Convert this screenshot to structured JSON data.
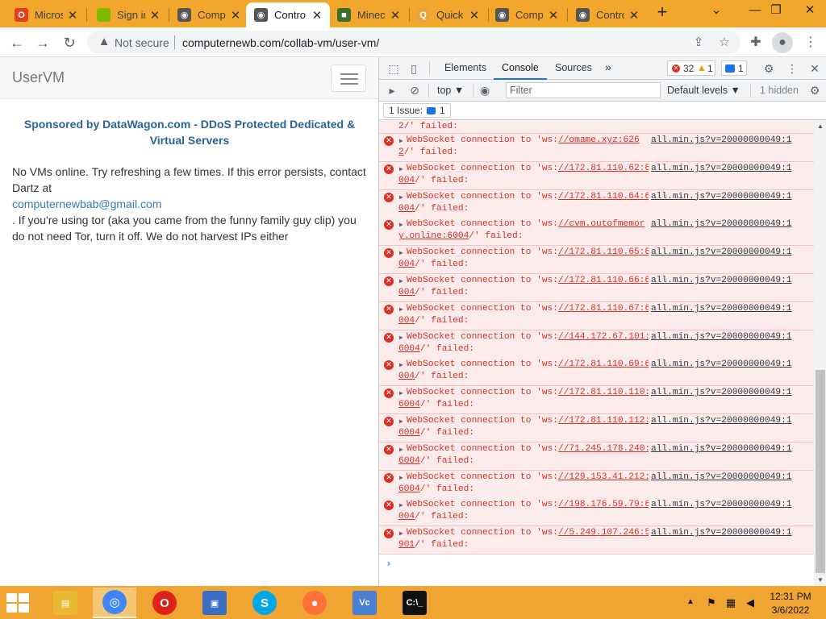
{
  "tabs": [
    {
      "title": "Micros",
      "icon": "office-icon",
      "color": "#e53e1f",
      "glyph": "O"
    },
    {
      "title": "Sign in",
      "icon": "microsoft-icon",
      "color": "#7fba00",
      "glyph": ""
    },
    {
      "title": "Comp",
      "icon": "collabvm-icon",
      "color": "#555555",
      "glyph": "◉"
    },
    {
      "title": "Contro",
      "icon": "collabvm-icon",
      "color": "#555555",
      "glyph": "◉"
    },
    {
      "title": "Minec",
      "icon": "minecraft-icon",
      "color": "#3c6e2f",
      "glyph": "■"
    },
    {
      "title": "Quick",
      "icon": "search-icon",
      "color": "#e8a33c",
      "glyph": "Q"
    },
    {
      "title": "Comp",
      "icon": "collabvm-icon",
      "color": "#555555",
      "glyph": "◉"
    },
    {
      "title": "Contro",
      "icon": "collabvm-icon",
      "color": "#555555",
      "glyph": "◉"
    }
  ],
  "active_tab_index": 3,
  "address": {
    "security": "Not secure",
    "url": "computernewb.com/collab-vm/user-vm/"
  },
  "page": {
    "brand": "UserVM",
    "sponsor": "Sponsored by DataWagon.com - DDoS Protected Dedicated & Virtual Servers",
    "message_1": "No VMs online. Try refreshing a few times. If this error persists, contact Dartz at",
    "email": "computernewbab@gmail.com",
    "message_2": ". If you're using tor (aka you came from the funny family guy clip) you do not need Tor, turn it off. We do not harvest IPs either"
  },
  "devtools": {
    "tabs": [
      "Elements",
      "Console",
      "Sources"
    ],
    "more": "»",
    "error_count": "32",
    "warning_count": "1",
    "issue_count": "1",
    "context": "top ▼",
    "filter_placeholder": "Filter",
    "levels": "Default levels ▼",
    "hidden": "1 hidden",
    "issues_label": "1 Issue:",
    "issues_count": "1",
    "top_fragment": "2/' failed:",
    "source_link": "all.min.js?v=20000000049:1",
    "prompt": "›",
    "messages": [
      {
        "pre": "WebSocket connection to 'ws:",
        "url1": "//omame.xyz:626",
        "url2": "2",
        "post": "/' failed:"
      },
      {
        "pre": "WebSocket connection to 'ws:",
        "url1": "//172.81.110.62:6",
        "url2": "004",
        "post": "/' failed:"
      },
      {
        "pre": "WebSocket connection to 'ws:",
        "url1": "//172.81.110.64:6",
        "url2": "004",
        "post": "/' failed:"
      },
      {
        "pre": "WebSocket connection to 'ws:",
        "url1": "//cvm.outofmemor",
        "url2": "y.online:6004",
        "post": "/' failed:"
      },
      {
        "pre": "WebSocket connection to 'ws:",
        "url1": "//172.81.110.65:6",
        "url2": "004",
        "post": "/' failed:"
      },
      {
        "pre": "WebSocket connection to 'ws:",
        "url1": "//172.81.110.66:6",
        "url2": "004",
        "post": "/' failed:"
      },
      {
        "pre": "WebSocket connection to 'ws:",
        "url1": "//172.81.110.67:6",
        "url2": "004",
        "post": "/' failed:"
      },
      {
        "pre": "WebSocket connection to 'ws:",
        "url1": "//144.172.67.101:",
        "url2": "6004",
        "post": "/' failed:"
      },
      {
        "pre": "WebSocket connection to 'ws:",
        "url1": "//172.81.110.69:6",
        "url2": "004",
        "post": "/' failed:"
      },
      {
        "pre": "WebSocket connection to 'ws:",
        "url1": "//172.81.110.110:",
        "url2": "6004",
        "post": "/' failed:"
      },
      {
        "pre": "WebSocket connection to 'ws:",
        "url1": "//172.81.110.112:",
        "url2": "6004",
        "post": "/' failed:"
      },
      {
        "pre": "WebSocket connection to 'ws:",
        "url1": "//71.245.178.240:",
        "url2": "6004",
        "post": "/' failed:"
      },
      {
        "pre": "WebSocket connection to 'ws:",
        "url1": "//129.153.41.212:",
        "url2": "6004",
        "post": "/' failed:"
      },
      {
        "pre": "WebSocket connection to 'ws:",
        "url1": "//198.176.59.79:6",
        "url2": "004",
        "post": "/' failed:"
      },
      {
        "pre": "WebSocket connection to 'ws:",
        "url1": "//5.249.107.246:5",
        "url2": "901",
        "post": "/' failed:"
      }
    ]
  },
  "taskbar": {
    "apps": [
      {
        "name": "file-explorer-icon",
        "color": "#e8b931",
        "glyph": "▤"
      },
      {
        "name": "chrome-icon",
        "color": "#4285f4",
        "glyph": "◎"
      },
      {
        "name": "opera-icon",
        "color": "#e0201b",
        "glyph": "O"
      },
      {
        "name": "network-setup-icon",
        "color": "#3a6fc4",
        "glyph": "▣"
      },
      {
        "name": "skype-icon",
        "color": "#00a8e8",
        "glyph": "S"
      },
      {
        "name": "firefox-icon",
        "color": "#ff7139",
        "glyph": "●"
      },
      {
        "name": "vc-icon",
        "color": "#4a7fd6",
        "glyph": "Vc"
      },
      {
        "name": "command-prompt-icon",
        "color": "#111111",
        "glyph": "C:\\_"
      }
    ],
    "active_app_index": 1,
    "time": "12:31 PM",
    "date": "3/6/2022"
  }
}
